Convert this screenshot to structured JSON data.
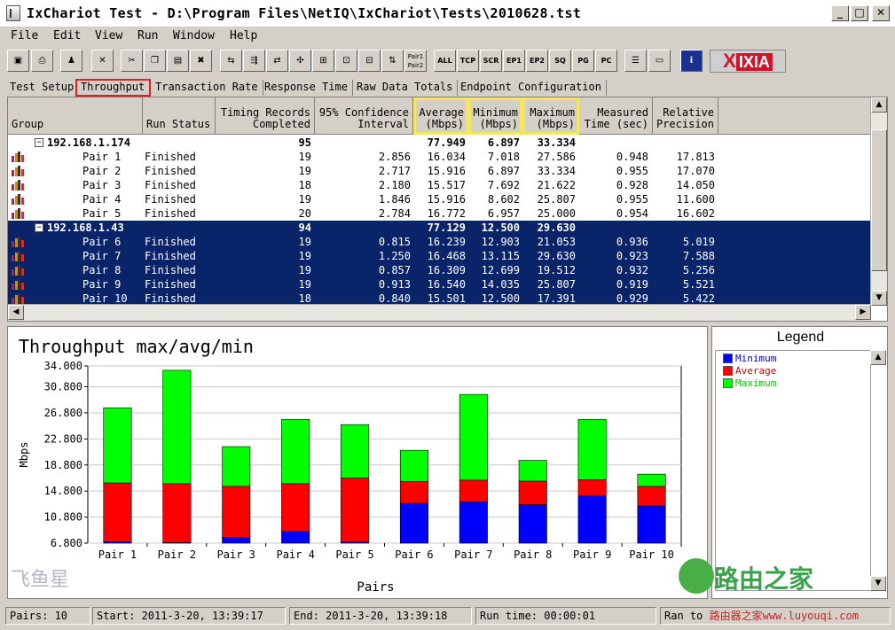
{
  "window": {
    "title": "IxChariot Test - D:\\Program Files\\NetIQ\\IxChariot\\Tests\\2010628.tst",
    "min": "_",
    "max": "□",
    "close": "✕"
  },
  "menu": [
    "File",
    "Edit",
    "View",
    "Run",
    "Window",
    "Help"
  ],
  "toolbar": {
    "text_buttons": [
      "ALL",
      "TCP",
      "SCR",
      "EP1",
      "EP2",
      "SQ",
      "PG",
      "PC"
    ],
    "pair_button": "Pair1 Pair2",
    "logo": "IXIA"
  },
  "tabs": [
    "Test Setup",
    "Throughput",
    "Transaction Rate",
    "Response Time",
    "Raw Data Totals",
    "Endpoint Configuration"
  ],
  "active_tab": "Throughput",
  "grid": {
    "headers": [
      "Group",
      "Run Status",
      "Timing Records\nCompleted",
      "95% Confidence\nInterval",
      "Average\n(Mbps)",
      "Minimum\n(Mbps)",
      "Maximum\n(Mbps)",
      "Measured\nTime (sec)",
      "Relative\nPrecision"
    ],
    "rows": [
      {
        "kind": "group",
        "name": "192.168.1.174",
        "status": "",
        "records": "95",
        "ci": "",
        "avg": "77.949",
        "min": "6.897",
        "max": "33.334",
        "time": "",
        "prec": "",
        "selected": false
      },
      {
        "kind": "pair",
        "name": "Pair 1",
        "status": "Finished",
        "records": "19",
        "ci": "2.856",
        "avg": "16.034",
        "min": "7.018",
        "max": "27.586",
        "time": "0.948",
        "prec": "17.813",
        "selected": false
      },
      {
        "kind": "pair",
        "name": "Pair 2",
        "status": "Finished",
        "records": "19",
        "ci": "2.717",
        "avg": "15.916",
        "min": "6.897",
        "max": "33.334",
        "time": "0.955",
        "prec": "17.070",
        "selected": false
      },
      {
        "kind": "pair",
        "name": "Pair 3",
        "status": "Finished",
        "records": "18",
        "ci": "2.180",
        "avg": "15.517",
        "min": "7.692",
        "max": "21.622",
        "time": "0.928",
        "prec": "14.050",
        "selected": false
      },
      {
        "kind": "pair",
        "name": "Pair 4",
        "status": "Finished",
        "records": "19",
        "ci": "1.846",
        "avg": "15.916",
        "min": "8.602",
        "max": "25.807",
        "time": "0.955",
        "prec": "11.600",
        "selected": false
      },
      {
        "kind": "pair",
        "name": "Pair 5",
        "status": "Finished",
        "records": "20",
        "ci": "2.784",
        "avg": "16.772",
        "min": "6.957",
        "max": "25.000",
        "time": "0.954",
        "prec": "16.602",
        "selected": false
      },
      {
        "kind": "group",
        "name": "192.168.1.43",
        "status": "",
        "records": "94",
        "ci": "",
        "avg": "77.129",
        "min": "12.500",
        "max": "29.630",
        "time": "",
        "prec": "",
        "selected": true
      },
      {
        "kind": "pair",
        "name": "Pair 6",
        "status": "Finished",
        "records": "19",
        "ci": "0.815",
        "avg": "16.239",
        "min": "12.903",
        "max": "21.053",
        "time": "0.936",
        "prec": "5.019",
        "selected": true
      },
      {
        "kind": "pair",
        "name": "Pair 7",
        "status": "Finished",
        "records": "19",
        "ci": "1.250",
        "avg": "16.468",
        "min": "13.115",
        "max": "29.630",
        "time": "0.923",
        "prec": "7.588",
        "selected": true
      },
      {
        "kind": "pair",
        "name": "Pair 8",
        "status": "Finished",
        "records": "19",
        "ci": "0.857",
        "avg": "16.309",
        "min": "12.699",
        "max": "19.512",
        "time": "0.932",
        "prec": "5.256",
        "selected": true
      },
      {
        "kind": "pair",
        "name": "Pair 9",
        "status": "Finished",
        "records": "19",
        "ci": "0.913",
        "avg": "16.540",
        "min": "14.035",
        "max": "25.807",
        "time": "0.919",
        "prec": "5.521",
        "selected": true
      },
      {
        "kind": "pair",
        "name": "Pair 10",
        "status": "Finished",
        "records": "18",
        "ci": "0.840",
        "avg": "15.501",
        "min": "12.500",
        "max": "17.391",
        "time": "0.929",
        "prec": "5.422",
        "selected": true
      }
    ]
  },
  "chart_data": {
    "type": "bar",
    "stacked_overlay": true,
    "title": "Throughput max/avg/min",
    "xlabel": "Pairs",
    "ylabel": "Mbps",
    "categories": [
      "Pair 1",
      "Pair 2",
      "Pair 3",
      "Pair 4",
      "Pair 5",
      "Pair 6",
      "Pair 7",
      "Pair 8",
      "Pair 9",
      "Pair 10"
    ],
    "series": [
      {
        "name": "Minimum",
        "color": "#0000ff",
        "values": [
          7.018,
          6.897,
          7.692,
          8.602,
          6.957,
          12.903,
          13.115,
          12.699,
          14.035,
          12.5
        ]
      },
      {
        "name": "Average",
        "color": "#ff0000",
        "values": [
          16.034,
          15.916,
          15.517,
          15.916,
          16.772,
          16.239,
          16.468,
          16.309,
          16.54,
          15.501
        ]
      },
      {
        "name": "Maximum",
        "color": "#00ff00",
        "values": [
          27.586,
          33.334,
          21.622,
          25.807,
          25.0,
          21.053,
          29.63,
          19.512,
          25.807,
          17.391
        ]
      }
    ],
    "yticks": [
      "34.000",
      "30.800",
      "26.800",
      "22.800",
      "18.800",
      "14.800",
      "10.800",
      "6.800"
    ],
    "ylim": [
      6.8,
      34.0
    ],
    "grid": true,
    "legend": "right panel"
  },
  "legend": {
    "title": "Legend"
  },
  "status": {
    "pairs": "Pairs: 10",
    "start": "Start: 2011-3-20, 13:39:17",
    "end": "End: 2011-3-20, 13:39:18",
    "runtime": "Run time: 00:00:01",
    "ran_to": "Ran to"
  },
  "watermarks": {
    "left": "飞鱼星",
    "right": "路由之家",
    "bottom_right": "路由器之家www.luyouqi.com"
  }
}
